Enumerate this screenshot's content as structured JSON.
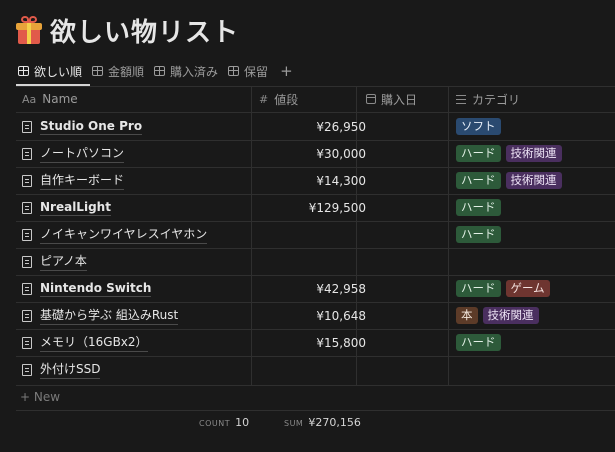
{
  "page": {
    "title": "欲しい物リスト",
    "icon": "gift-icon"
  },
  "tabs": [
    {
      "label": "欲しい順",
      "icon": "table-icon",
      "active": true
    },
    {
      "label": "金額順",
      "icon": "table-icon",
      "active": false
    },
    {
      "label": "購入済み",
      "icon": "table-icon",
      "active": false
    },
    {
      "label": "保留",
      "icon": "table-icon",
      "active": false
    }
  ],
  "tab_add_label": "+",
  "columns": {
    "name": {
      "icon": "Aa",
      "label": "Name"
    },
    "price": {
      "icon": "#",
      "label": "値段"
    },
    "purchase_date": {
      "icon": "calendar-icon",
      "label": "購入日"
    },
    "category": {
      "icon": "list-icon",
      "label": "カテゴリ"
    }
  },
  "tag_colors": {
    "ソフト": {
      "bg": "#2a4a70",
      "fg": "#e6eef8"
    },
    "ハード": {
      "bg": "#2d5a3a",
      "fg": "#e2f0e6"
    },
    "技術関連": {
      "bg": "#4a2f5f",
      "fg": "#ece2f4"
    },
    "ゲーム": {
      "bg": "#6e3530",
      "fg": "#f6e4e2"
    },
    "本": {
      "bg": "#5c3b28",
      "fg": "#f4e8de"
    }
  },
  "rows": [
    {
      "name": "Studio One Pro",
      "bold": true,
      "price": "¥26,950",
      "tags": [
        "ソフト"
      ]
    },
    {
      "name": "ノートパソコン",
      "bold": false,
      "price": "¥30,000",
      "tags": [
        "ハード",
        "技術関連"
      ]
    },
    {
      "name": "自作キーボード",
      "bold": false,
      "price": "¥14,300",
      "tags": [
        "ハード",
        "技術関連"
      ]
    },
    {
      "name": "NrealLight",
      "bold": true,
      "price": "¥129,500",
      "tags": [
        "ハード"
      ]
    },
    {
      "name": "ノイキャンワイヤレスイヤホン",
      "bold": false,
      "price": "",
      "tags": [
        "ハード"
      ]
    },
    {
      "name": "ピアノ本",
      "bold": false,
      "price": "",
      "tags": []
    },
    {
      "name": "Nintendo Switch",
      "bold": true,
      "price": "¥42,958",
      "tags": [
        "ハード",
        "ゲーム"
      ]
    },
    {
      "name": "基礎から学ぶ 組込みRust",
      "bold": false,
      "price": "¥10,648",
      "tags": [
        "本",
        "技術関連"
      ]
    },
    {
      "name": "メモリ（16GBx2）",
      "bold": false,
      "price": "¥15,800",
      "tags": [
        "ハード"
      ]
    },
    {
      "name": "外付けSSD",
      "bold": false,
      "price": "",
      "tags": []
    }
  ],
  "new_row_label": "+ New",
  "footer": {
    "count_label": "COUNT",
    "count_value": "10",
    "sum_label": "SUM",
    "sum_value": "¥270,156"
  }
}
